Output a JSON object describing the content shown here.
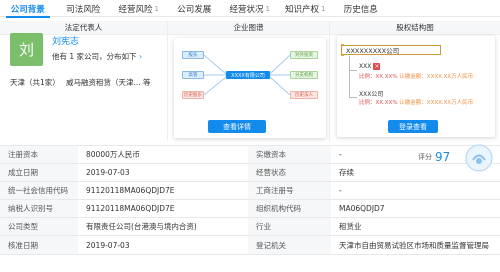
{
  "tabs": [
    {
      "label": "公司背景",
      "badge": "",
      "active": true
    },
    {
      "label": "司法风险",
      "badge": "",
      "active": false
    },
    {
      "label": "经营风险",
      "badge": "1",
      "active": false
    },
    {
      "label": "公司发展",
      "badge": "",
      "active": false
    },
    {
      "label": "经营状况",
      "badge": "1",
      "active": false
    },
    {
      "label": "知识产权",
      "badge": "1",
      "active": false
    },
    {
      "label": "历史信息",
      "badge": "",
      "active": false
    }
  ],
  "legal_rep": {
    "header": "法定代表人",
    "avatar_char": "刘",
    "name": "刘宪志",
    "summary": "他有 1 家公司，分布如下",
    "location": "天津（共1家）",
    "company": "威马融资租赁（天津...   等"
  },
  "enterprise_map": {
    "header": "企业图谱",
    "center_node": "XXXX有限公司",
    "left_nodes": [
      "股东",
      "高管",
      "历史股东"
    ],
    "right_nodes": [
      "对外投资",
      "分支机构",
      "历史法人"
    ],
    "button": "查看详情"
  },
  "equity": {
    "header": "股权结构图",
    "company": "XXXXXXXXX公司",
    "shareholders": [
      {
        "name": "XXX",
        "pct": "比例：XX.XX%",
        "amount": "认缴金额：XXXX.XX万人民币"
      },
      {
        "name": "XXX公司",
        "pct": "比例：XX.XX%",
        "amount": "认缴金额：XXXX.XX万人民币"
      }
    ],
    "button": "登录查看"
  },
  "score": {
    "label": "评分",
    "value": "97"
  },
  "table": [
    [
      "注册资本",
      "80000万人民币",
      "实缴资本",
      "-"
    ],
    [
      "成立日期",
      "2019-07-03",
      "经营状态",
      "存续"
    ],
    [
      "统一社会信用代码",
      "91120118MA06QDJD7E",
      "工商注册号",
      "-"
    ],
    [
      "纳税人识别号",
      "91120118MA06QDJD7E",
      "组织机构代码",
      "MA06QDJD7"
    ],
    [
      "公司类型",
      "有限责任公司(台港澳与境内合资)",
      "行业",
      "租赁业"
    ],
    [
      "核准日期",
      "2019-07-03",
      "登记机关",
      "天津市自由贸易试验区市场和质量监督管理局"
    ]
  ],
  "colors": {
    "accent": "#128bed",
    "avatar": "#7cbf6b",
    "warning": "#e04a4a"
  }
}
